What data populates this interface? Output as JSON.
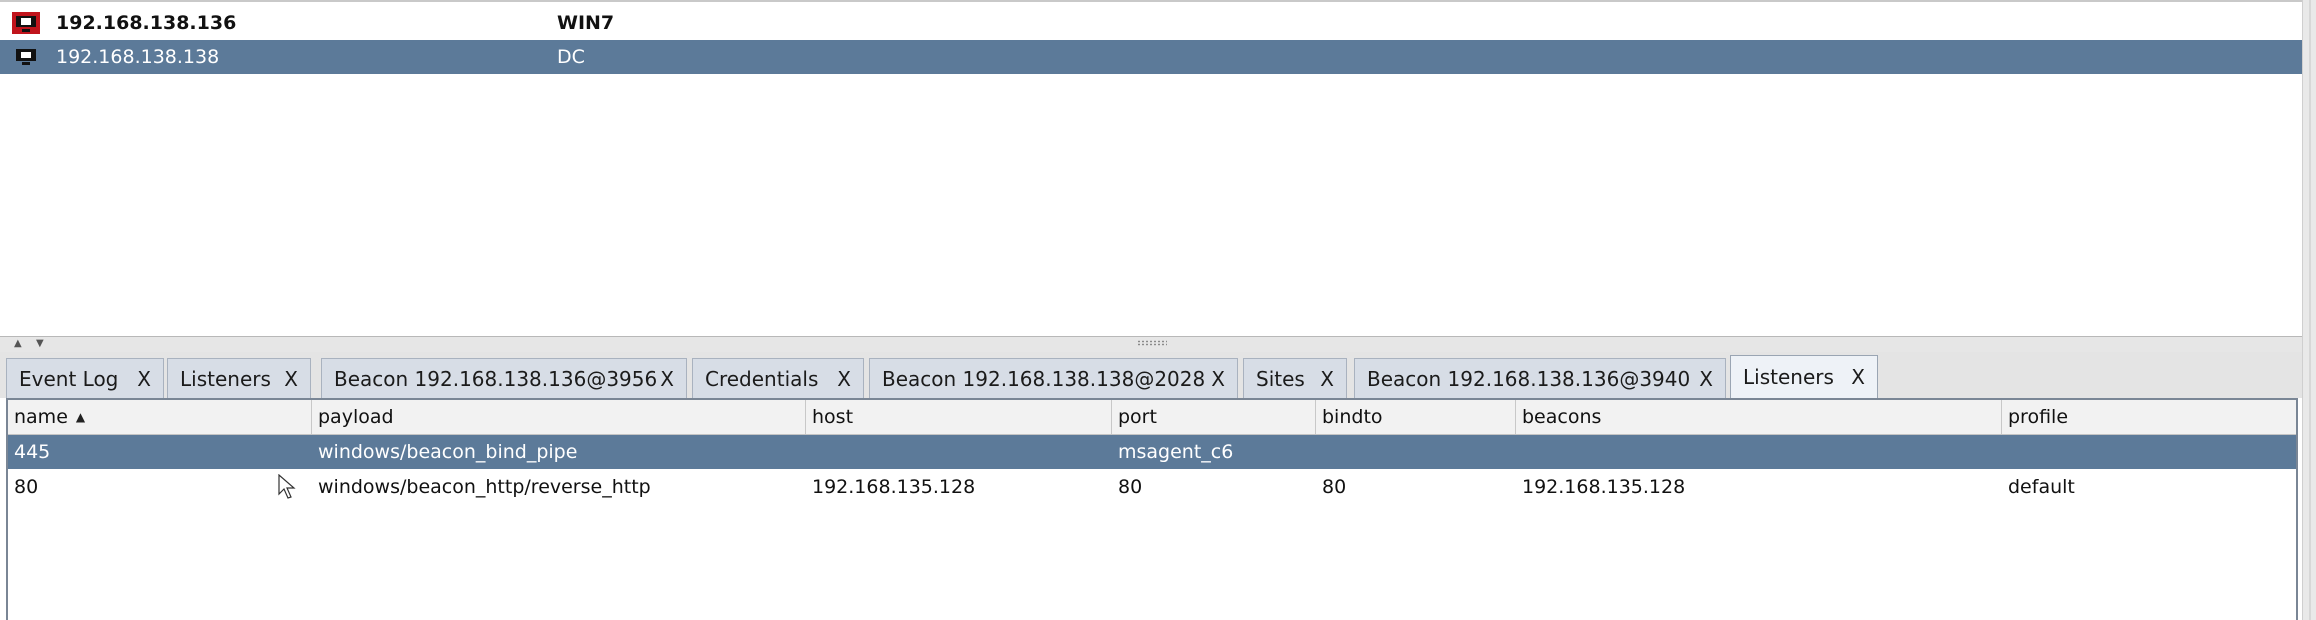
{
  "sessions": [
    {
      "ip": "192.168.138.136",
      "computer": "WIN7",
      "bold": true,
      "selected": false,
      "icon": "compromised-host-icon"
    },
    {
      "ip": "192.168.138.138",
      "computer": "DC",
      "bold": false,
      "selected": true,
      "icon": "host-icon"
    }
  ],
  "tabs": [
    {
      "label": "Event Log",
      "close": "X"
    },
    {
      "label": "Listeners",
      "close": "X"
    },
    {
      "label": "Beacon 192.168.138.136@3956",
      "close": "X"
    },
    {
      "label": "Credentials",
      "close": "X"
    },
    {
      "label": "Beacon 192.168.138.138@2028",
      "close": "X"
    },
    {
      "label": "Sites",
      "close": "X"
    },
    {
      "label": "Beacon 192.168.138.136@3940",
      "close": "X"
    },
    {
      "label": "Listeners",
      "close": "X",
      "active": true
    }
  ],
  "listeners": {
    "columns": [
      "name",
      "payload",
      "host",
      "port",
      "bindto",
      "beacons",
      "profile"
    ],
    "sort_column": "name",
    "sort_direction": "ascending",
    "rows": [
      {
        "name": "445",
        "payload": "windows/beacon_bind_pipe",
        "host": "",
        "port": "msagent_c6",
        "bindto": "",
        "beacons": "",
        "profile": "",
        "selected": true
      },
      {
        "name": "80",
        "payload": "windows/beacon_http/reverse_http",
        "host": "192.168.135.128",
        "port": "80",
        "bindto": "80",
        "beacons": "192.168.135.128",
        "profile": "default",
        "selected": false
      }
    ]
  },
  "colors": {
    "selection": "#5c7a99",
    "compromised_icon": "#c0141c"
  }
}
